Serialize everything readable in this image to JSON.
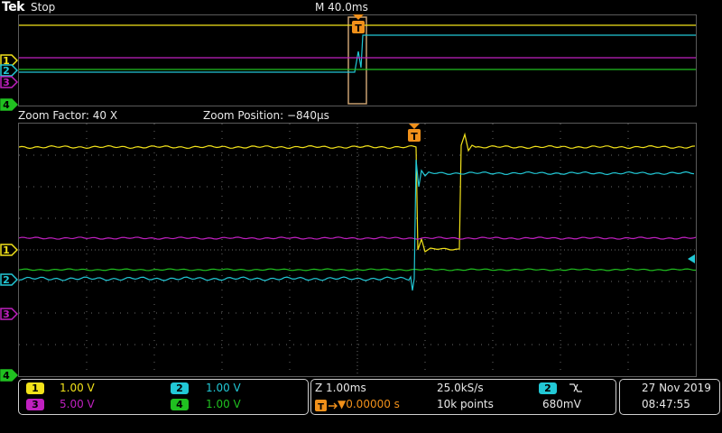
{
  "header": {
    "brand": "Tek",
    "run_state": "Stop",
    "horizontal_scale": "M 40.0ms",
    "trigger_marker": "T"
  },
  "zoom": {
    "factor": "Zoom Factor: 40 X",
    "position": "Zoom Position: −840µs"
  },
  "channel_markers": {
    "ch1": "1",
    "ch2": "2",
    "ch3": "3",
    "ch4": "4"
  },
  "channels": [
    {
      "number": "1",
      "scale": "1.00 V",
      "color": "#f2e21a"
    },
    {
      "number": "2",
      "scale": "1.00 V",
      "color": "#22c8d6"
    },
    {
      "number": "3",
      "scale": "5.00 V",
      "color": "#c020c0"
    },
    {
      "number": "4",
      "scale": "1.00 V",
      "color": "#20c020"
    }
  ],
  "timebase": {
    "zoom_scale": "Z 1.00ms",
    "sample_rate": "25.0kS/s",
    "trigger_delay": "▼0.00000 s",
    "record_length": "10k points"
  },
  "trigger": {
    "source": "2",
    "slope_icon": "falling-edge-icon",
    "level": "680mV"
  },
  "datetime": {
    "date": "27 Nov 2019",
    "time": "08:47:55"
  },
  "colors": {
    "ch1": "#f2e21a",
    "ch2": "#22c8d6",
    "ch3": "#c020c0",
    "ch4": "#20c020",
    "trigger": "#f0901a",
    "grid": "#6a6a6a"
  }
}
